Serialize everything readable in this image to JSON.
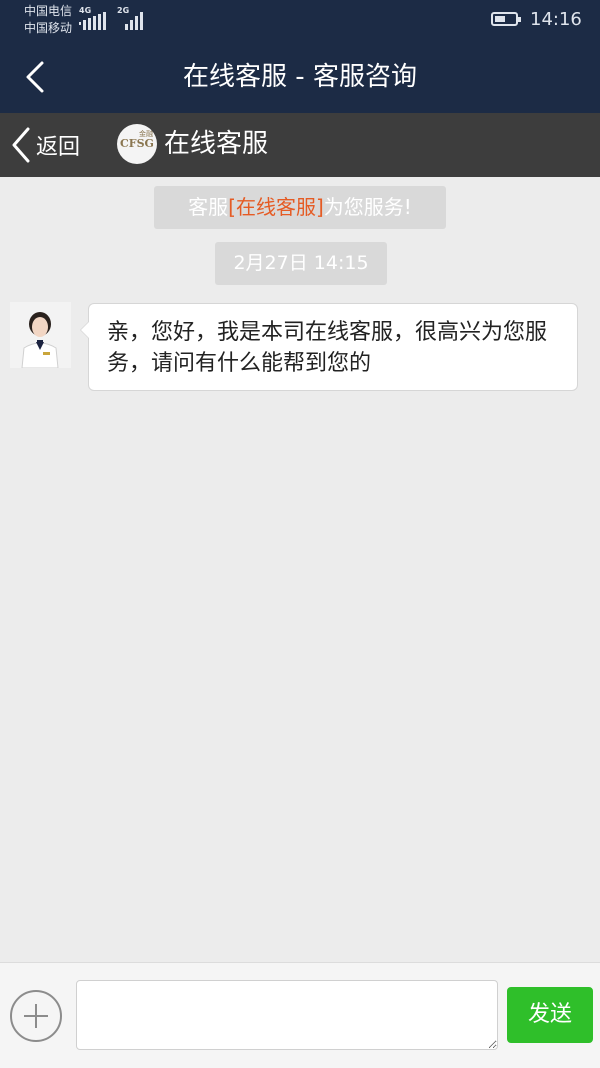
{
  "status_bar": {
    "carrier_1": "中国电信",
    "carrier_2": "中国移动",
    "network_1": "4G",
    "network_2": "2G",
    "time": "14:16",
    "battery_level": 0.5
  },
  "nav": {
    "title": "在线客服 - 客服咨询"
  },
  "sub_header": {
    "back_label": "返回",
    "logo_text": "CFSG",
    "logo_small_text": "金融",
    "name": "在线客服"
  },
  "system_notice": {
    "prefix": "客服",
    "highlight": "[在线客服]",
    "suffix": "为您服务!"
  },
  "timestamp": "2月27日 14:15",
  "messages": [
    {
      "sender": "agent",
      "text": "亲，您好，我是本司在线客服，很高兴为您服务，请问有什么能帮到您的"
    }
  ],
  "input_bar": {
    "placeholder": "",
    "send_label": "发送"
  },
  "colors": {
    "header_bg": "#1c2b45",
    "subheader_bg": "#3d3d3d",
    "chat_bg": "#ececec",
    "highlight": "#e55b24",
    "send_button": "#2fbf2a"
  }
}
